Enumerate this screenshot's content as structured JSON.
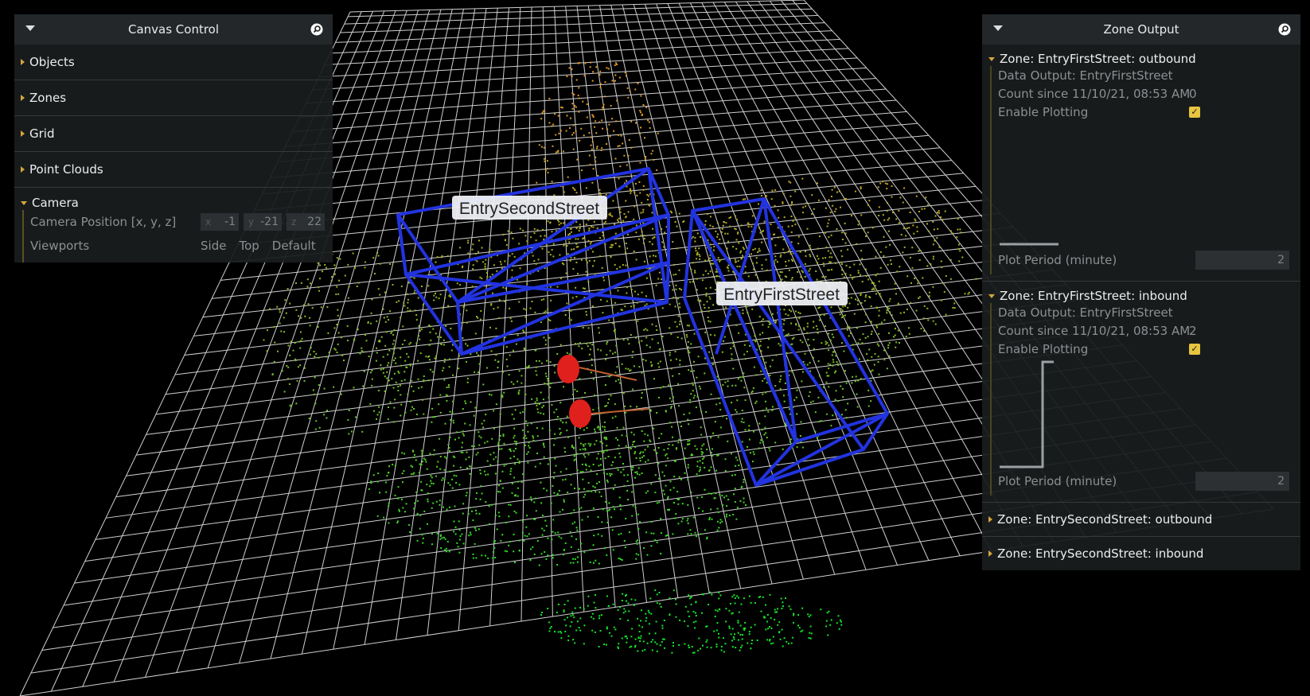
{
  "canvas_control": {
    "title": "Canvas Control",
    "folders": [
      {
        "label": "Objects"
      },
      {
        "label": "Zones"
      },
      {
        "label": "Grid"
      },
      {
        "label": "Point Clouds"
      }
    ],
    "camera": {
      "label": "Camera",
      "position_label": "Camera Position [x, y, z]",
      "x": {
        "axis": "x",
        "value": "-1"
      },
      "y": {
        "axis": "y",
        "value": "-21"
      },
      "z": {
        "axis": "z",
        "value": "22"
      },
      "viewports_label": "Viewports",
      "viewports": [
        "Side",
        "Top",
        "Default"
      ]
    }
  },
  "zone_output": {
    "title": "Zone Output",
    "zones_open": [
      {
        "title": "Zone: EntryFirstStreet: outbound",
        "data_output": "Data Output: EntryFirstStreet",
        "count_label": "Count since 11/10/21, 08:53 AM",
        "count": "0",
        "enable_plotting_label": "Enable Plotting",
        "enable_plotting": true,
        "plot_period_label": "Plot Period (minute)",
        "plot_period": "2"
      },
      {
        "title": "Zone: EntryFirstStreet: inbound",
        "data_output": "Data Output: EntryFirstStreet",
        "count_label": "Count since 11/10/21, 08:53 AM",
        "count": "2",
        "enable_plotting_label": "Enable Plotting",
        "enable_plotting": true,
        "plot_period_label": "Plot Period (minute)",
        "plot_period": "2"
      }
    ],
    "zones_closed": [
      {
        "title": "Zone: EntrySecondStreet: outbound"
      },
      {
        "title": "Zone: EntrySecondStreet: inbound"
      }
    ]
  },
  "scene_labels": {
    "second_street": "EntrySecondStreet",
    "first_street": "EntryFirstStreet"
  },
  "colors": {
    "zone_box": "#2233e0",
    "accent": "#d6a53c",
    "checkbox": "#e7c53f"
  },
  "icons": {
    "collapse": "caret-down-icon",
    "search": "search-icon",
    "folder_closed": "triangle-right-icon",
    "folder_open": "triangle-down-icon"
  }
}
